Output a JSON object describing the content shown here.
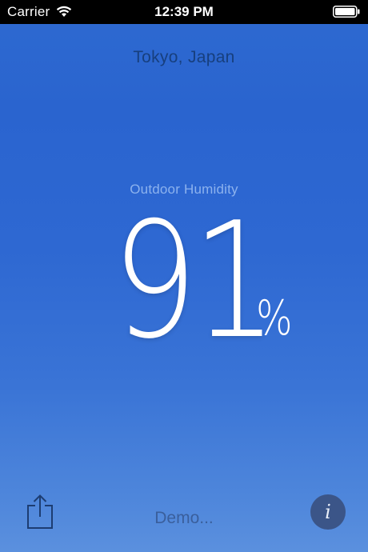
{
  "status_bar": {
    "carrier": "Carrier",
    "time": "12:39 PM",
    "icons": [
      "wifi-icon",
      "battery-icon"
    ]
  },
  "location": {
    "label": "Tokyo, Japan"
  },
  "reading": {
    "caption": "Outdoor Humidity",
    "value": "91",
    "unit": "%"
  },
  "footer": {
    "status_text": "Demo...",
    "share_icon": "share-icon",
    "info_label": "i"
  },
  "colors": {
    "background_top": "#2a64cf",
    "background_bottom": "#5b90de",
    "city_text": "#173f7e",
    "caption_text": "#8cb2ee",
    "info_button": "#3b5588"
  }
}
